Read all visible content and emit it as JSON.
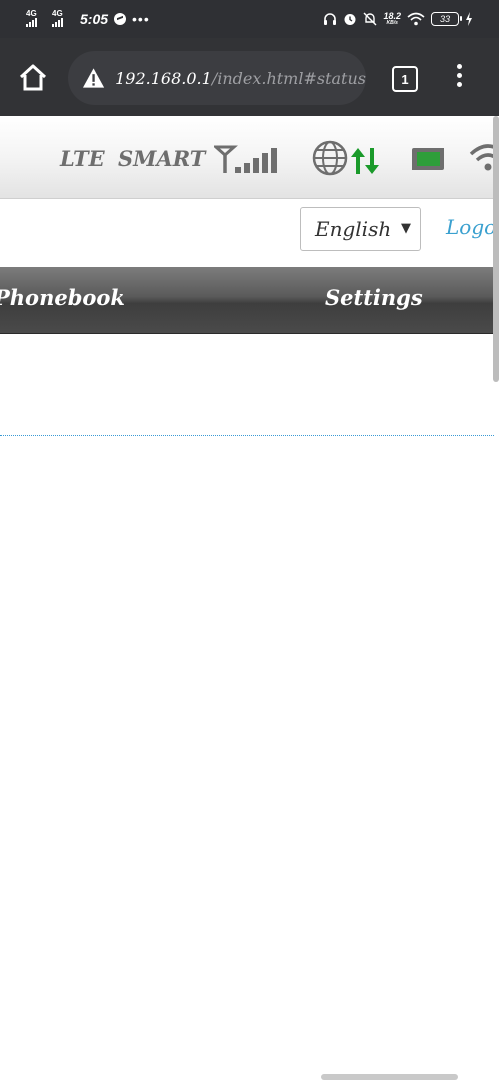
{
  "status_bar": {
    "sim1_label": "4G",
    "sim2_label": "4G",
    "time": "5:05",
    "more_indicator": "•••",
    "network_speed_value": "18.2",
    "network_speed_unit": "KB/s",
    "battery_level": "33",
    "icons": [
      "messenger-icon",
      "headphones-icon",
      "alarm-icon",
      "mute-icon",
      "wifi-icon",
      "battery-icon",
      "charging-icon"
    ]
  },
  "browser": {
    "url_host": "192.168.0.1",
    "url_path": "/index.html#status",
    "tab_count": "1",
    "icons": [
      "home-icon",
      "not-secure-warning-icon",
      "tabs-icon",
      "menu-icon"
    ]
  },
  "router": {
    "network_type": "LTE",
    "carrier": "SMART",
    "signal_bars": 5,
    "icons": [
      "signal-strength-icon",
      "globe-icon",
      "data-transfer-icon",
      "sim-card-icon",
      "wifi-icon"
    ],
    "language": {
      "selected": "English",
      "arrow": "▼"
    },
    "logout_label": "Logout",
    "nav": {
      "phonebook": "Phonebook",
      "settings": "Settings"
    },
    "colors": {
      "link": "#3aa0cf",
      "data_arrows": "#1a9a2a",
      "sim_card": "#2e9e3a"
    }
  }
}
